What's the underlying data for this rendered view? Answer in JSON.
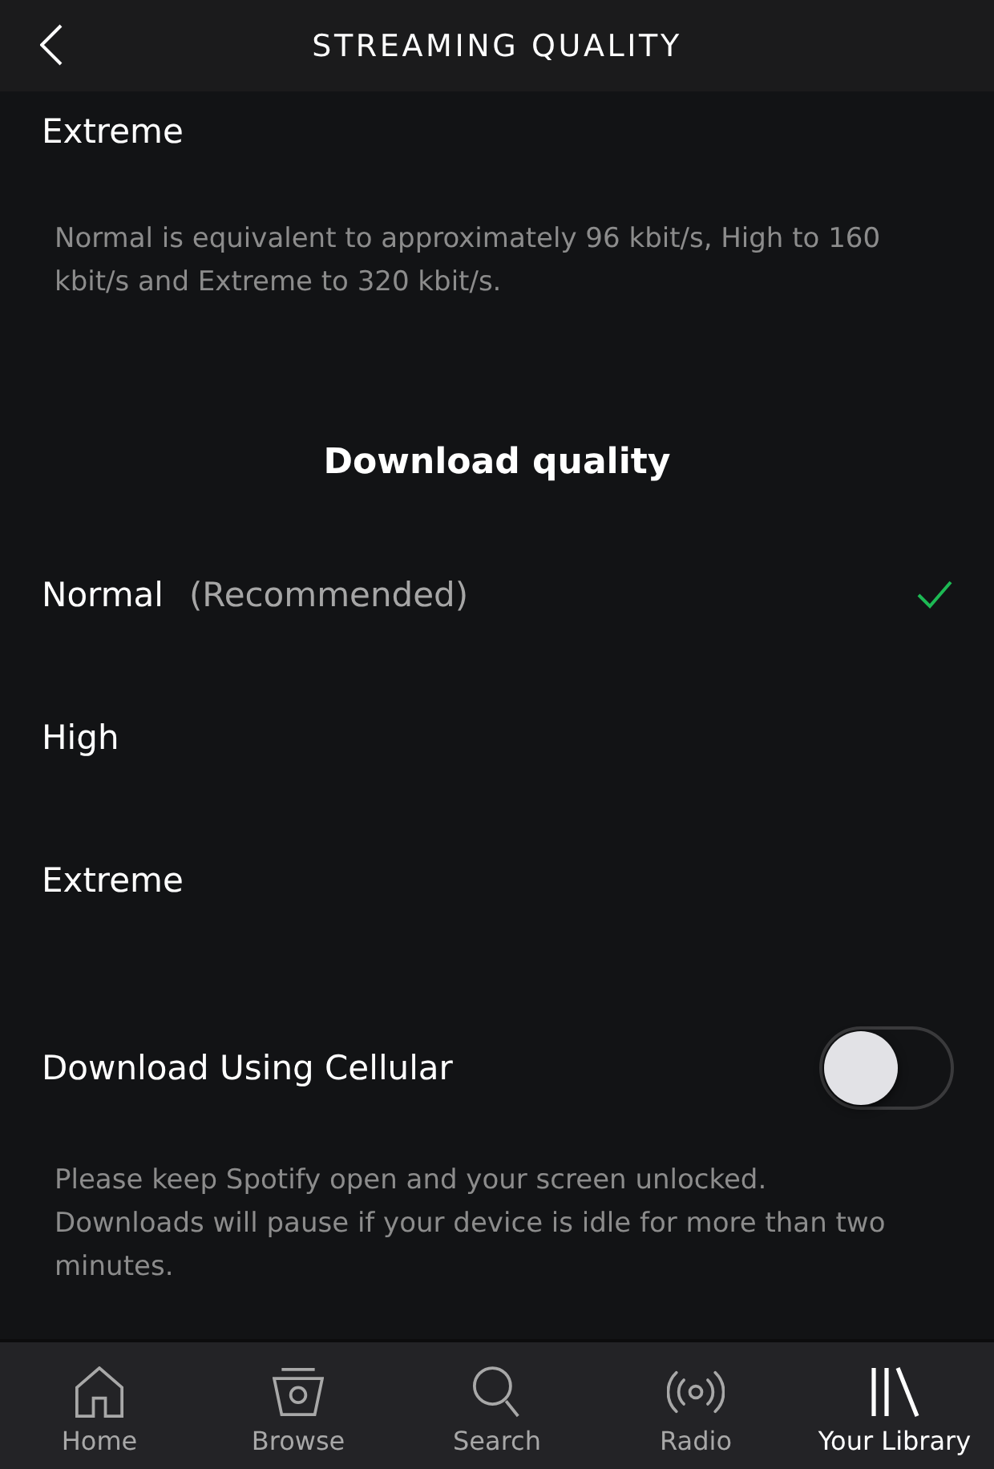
{
  "header": {
    "title": "STREAMING QUALITY"
  },
  "streaming_quality": {
    "options": [
      {
        "label": "Extreme",
        "selected": false
      }
    ],
    "note": "Normal is equivalent to approximately 96 kbit/s, High to 160 kbit/s and Extreme to 320 kbit/s."
  },
  "download_quality": {
    "title": "Download quality",
    "options": [
      {
        "label": "Normal",
        "hint": "(Recommended)",
        "selected": true
      },
      {
        "label": "High",
        "selected": false
      },
      {
        "label": "Extreme",
        "selected": false
      }
    ]
  },
  "cellular": {
    "label": "Download Using Cellular",
    "on": false,
    "note": "Please keep Spotify open and your screen unlocked. Downloads will pause if your device is idle for more than two minutes."
  },
  "tabs": [
    {
      "label": "Home",
      "selected": false
    },
    {
      "label": "Browse",
      "selected": false
    },
    {
      "label": "Search",
      "selected": false
    },
    {
      "label": "Radio",
      "selected": false
    },
    {
      "label": "Your Library",
      "selected": true
    }
  ]
}
